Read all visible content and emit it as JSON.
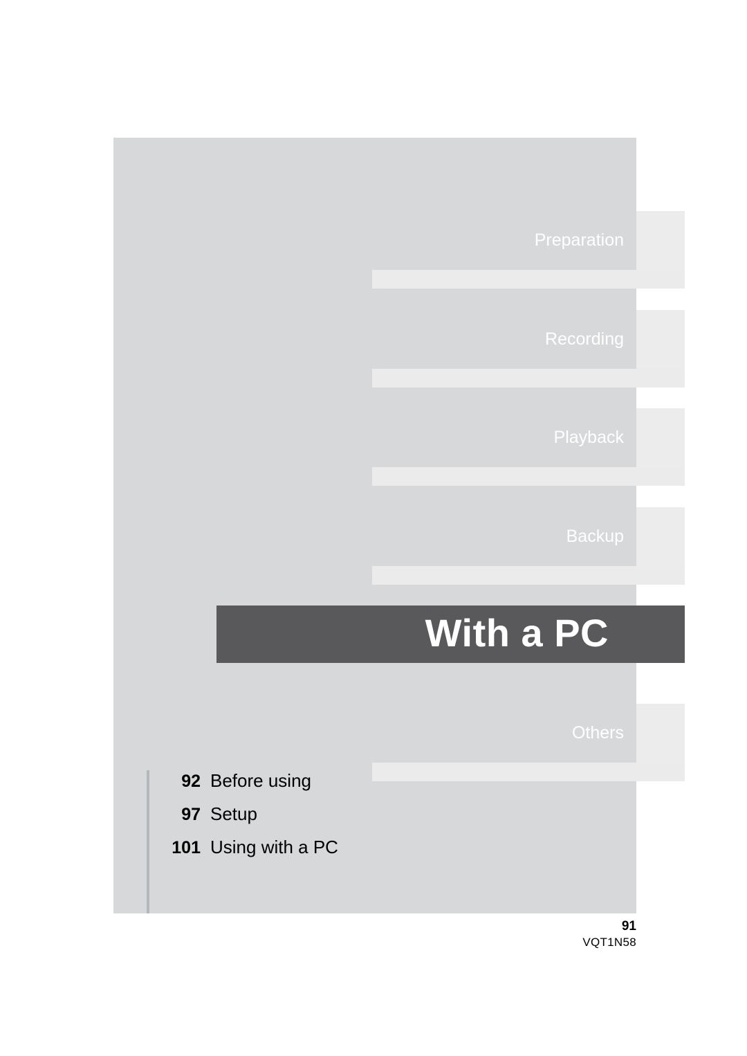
{
  "page": {
    "background_color": "#ffffff",
    "panel_color": "#d6d8d9"
  },
  "section_tabs": [
    {
      "label": "Preparation",
      "active": false
    },
    {
      "label": "Recording",
      "active": false
    },
    {
      "label": "Playback",
      "active": false
    },
    {
      "label": "Backup",
      "active": false
    },
    {
      "label": "With a PC",
      "active": true
    },
    {
      "label": "Others",
      "active": false
    }
  ],
  "active_section": {
    "title": "With a PC",
    "bar_color": "#59595c",
    "text_color": "#ffffff"
  },
  "contents": {
    "items": [
      {
        "page": "92",
        "label": "Before using"
      },
      {
        "page": "97",
        "label": "Setup"
      },
      {
        "page": "101",
        "label": "Using with a PC"
      }
    ]
  },
  "footer": {
    "page_number": "91",
    "document_code": "VQT1N58"
  }
}
